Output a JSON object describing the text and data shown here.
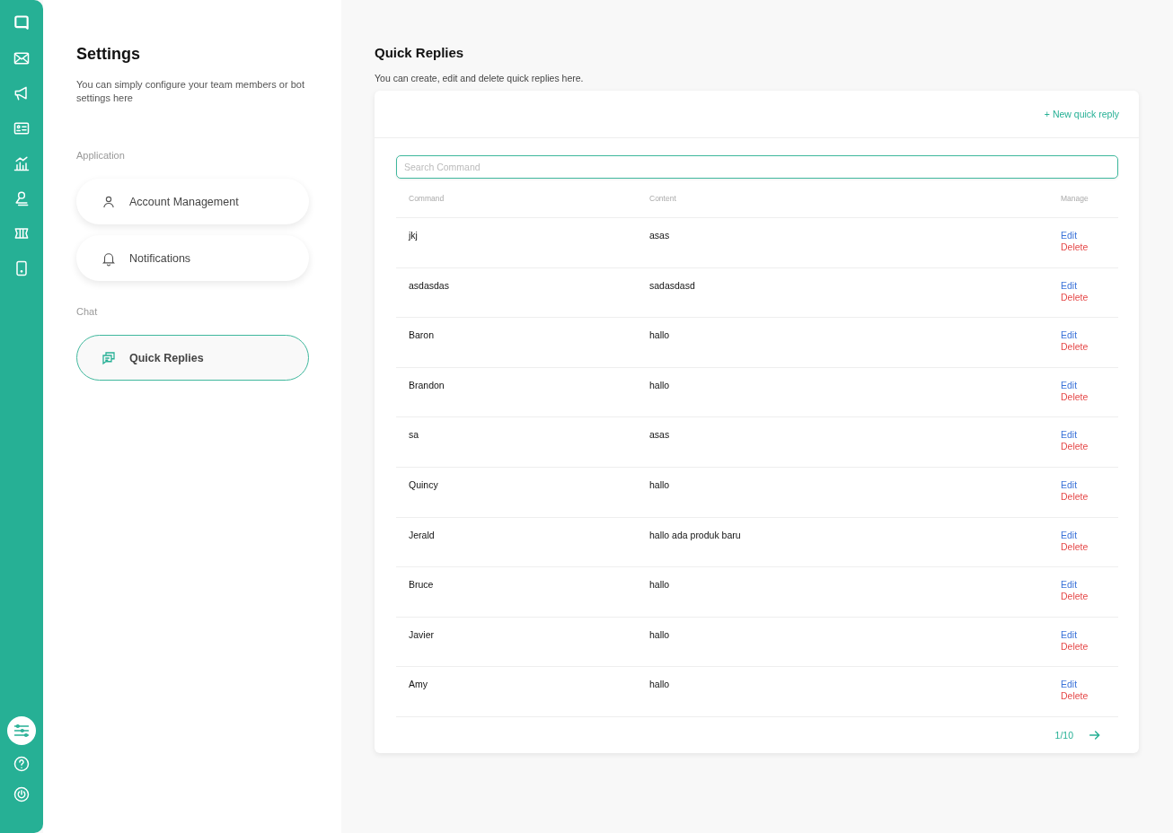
{
  "rail": {
    "items": [
      {
        "selected": true
      },
      {
        "selected": false
      },
      {
        "selected": false
      }
    ]
  },
  "settings": {
    "title": "Settings",
    "description": "You can simply configure your team members or bot settings here",
    "groups": [
      {
        "label": "Application",
        "items": [
          {
            "label": "Account Management",
            "selected": false
          },
          {
            "label": "Notifications",
            "selected": false
          }
        ]
      },
      {
        "label": "Chat",
        "items": [
          {
            "label": "Quick Replies",
            "selected": true
          }
        ]
      }
    ]
  },
  "main": {
    "title": "Quick Replies",
    "subtitle": "You can create, edit and delete quick replies here.",
    "new_button": "+ New quick reply",
    "search": {
      "placeholder": "Search Command"
    },
    "table": {
      "columns": [
        "Command",
        "Content",
        "Manage"
      ],
      "rows": [
        {
          "command": "jkj",
          "content": "asas",
          "edit": "Edit",
          "delete": "Delete"
        },
        {
          "command": "asdasdas",
          "content": "sadasdasd",
          "edit": "Edit",
          "delete": "Delete"
        },
        {
          "command": "Baron",
          "content": "hallo",
          "edit": "Edit",
          "delete": "Delete"
        },
        {
          "command": "Brandon",
          "content": "hallo",
          "edit": "Edit",
          "delete": "Delete"
        },
        {
          "command": "sa",
          "content": "asas",
          "edit": "Edit",
          "delete": "Delete"
        },
        {
          "command": "Quincy",
          "content": "hallo",
          "edit": "Edit",
          "delete": "Delete"
        },
        {
          "command": "Jerald",
          "content": "hallo ada produk baru",
          "edit": "Edit",
          "delete": "Delete"
        },
        {
          "command": "Bruce",
          "content": "hallo",
          "edit": "Edit",
          "delete": "Delete"
        },
        {
          "command": "Javier",
          "content": "hallo",
          "edit": "Edit",
          "delete": "Delete"
        },
        {
          "command": "Amy",
          "content": "hallo",
          "edit": "Edit",
          "delete": "Delete"
        }
      ]
    },
    "pagination": {
      "page": "1/10"
    }
  }
}
